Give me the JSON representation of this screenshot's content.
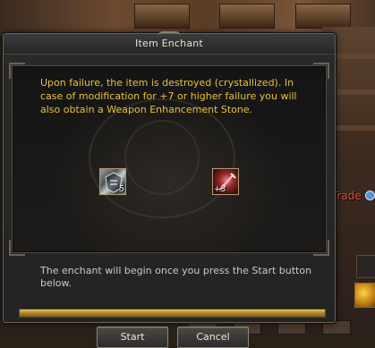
{
  "dialog": {
    "title": "Item Enchant",
    "warning": "Upon failure, the item is destroyed (crystallized). In case of modification for +7 or higher failure you will also obtain a Weapon Enhancement Stone.",
    "info": "The enchant will begin once you press the Start button below.",
    "scroll_slot": {
      "count": "5"
    },
    "target_slot": {
      "badge": "+3"
    },
    "progress": {
      "fraction": 1.0
    },
    "buttons": {
      "start_label": "Start",
      "cancel_label": "Cancel"
    }
  },
  "background": {
    "npc_label": "stTrade"
  },
  "colors": {
    "warning_text": "#e8c234",
    "info_text": "#cfcac0",
    "progress_fill": "#c9962f",
    "npc_label": "#e04a3a"
  }
}
